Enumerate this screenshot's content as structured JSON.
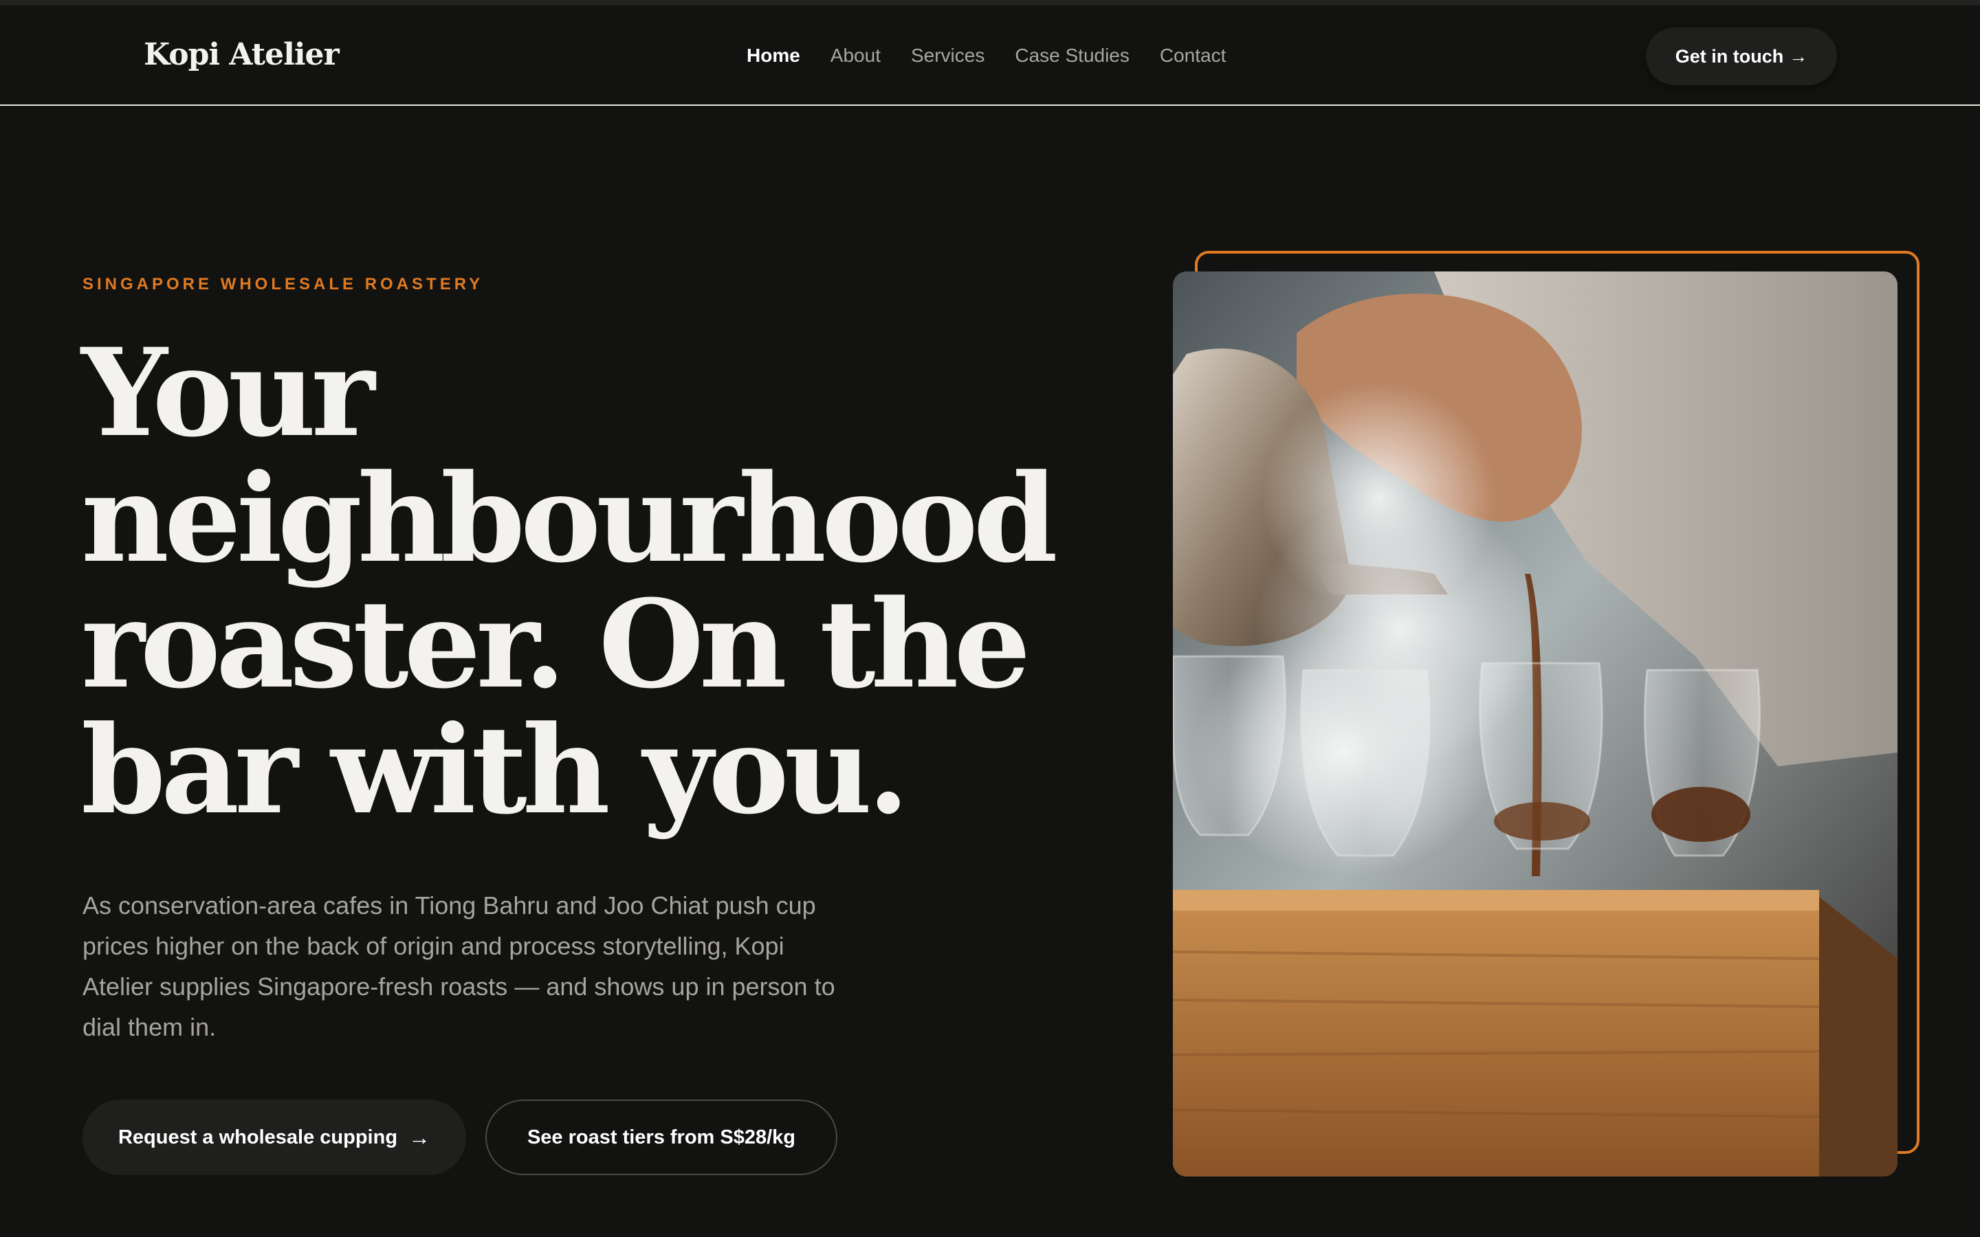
{
  "brand": {
    "name": "Kopi Atelier"
  },
  "nav": {
    "links": [
      {
        "label": "Home",
        "active": true
      },
      {
        "label": "About",
        "active": false
      },
      {
        "label": "Services",
        "active": false
      },
      {
        "label": "Case Studies",
        "active": false
      },
      {
        "label": "Contact",
        "active": false
      }
    ],
    "cta_label": "Get in touch",
    "cta_arrow": "→"
  },
  "hero": {
    "eyebrow": "SINGAPORE WHOLESALE ROASTERY",
    "headline_lines": [
      "Your",
      "neighbourhood",
      "roaster. On the",
      "bar with you."
    ],
    "lede": "As conservation-area cafes in Tiong Bahru and Joo Chiat push cup prices higher on the back of origin and process storytelling, Kopi Atelier supplies Singapore-fresh roasts — and shows up in person to dial them in.",
    "primary_cta": "Request a wholesale cupping",
    "primary_arrow": "→",
    "secondary_cta": "See roast tiers from S$28/kg"
  },
  "colors": {
    "background": "#121211",
    "accent": "#e07a22",
    "text": "#f4f2ee",
    "muted": "#a7a49e"
  },
  "image": {
    "subject": "kettle-pouring-coffee-into-glasses-photo"
  }
}
